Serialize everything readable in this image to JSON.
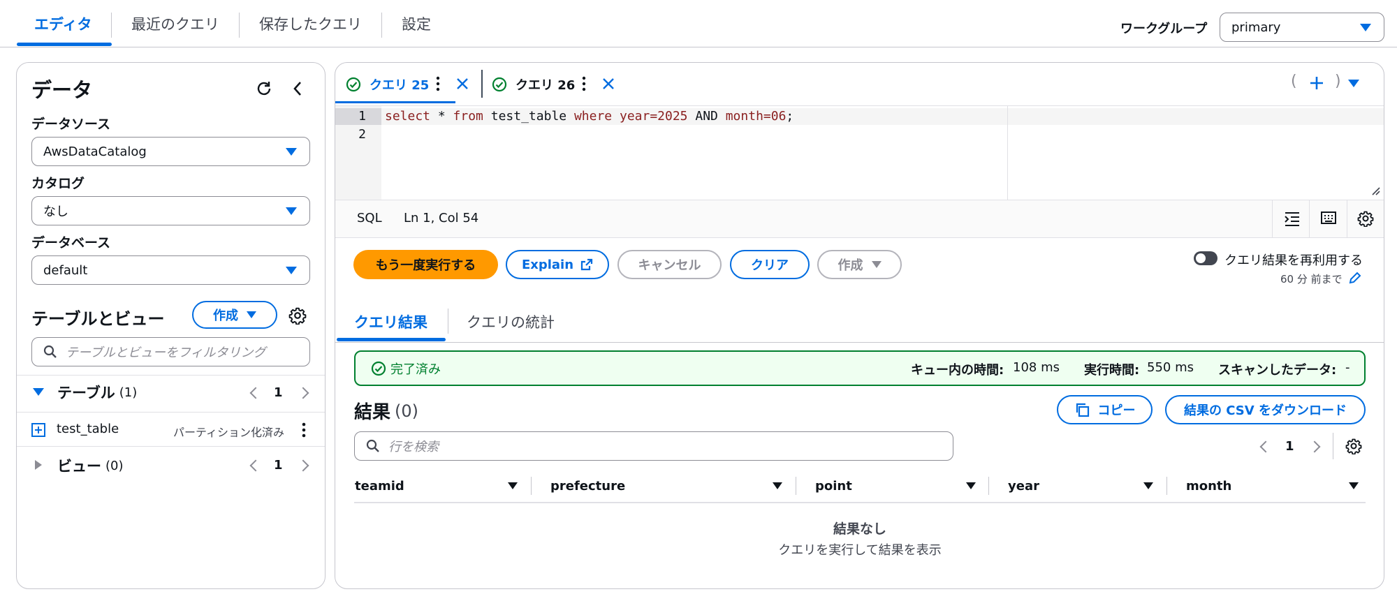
{
  "nav": {
    "tabs": [
      "エディタ",
      "最近のクエリ",
      "保存したクエリ",
      "設定"
    ],
    "workgroup_label": "ワークグループ",
    "workgroup_value": "primary"
  },
  "left": {
    "title": "データ",
    "datasource_label": "データソース",
    "datasource_value": "AwsDataCatalog",
    "catalog_label": "カタログ",
    "catalog_value": "なし",
    "database_label": "データベース",
    "database_value": "default",
    "tables_views_title": "テーブルとビュー",
    "create_label": "作成",
    "filter_placeholder": "テーブルとビューをフィルタリング",
    "tables_label": "テーブル",
    "tables_count": "(1)",
    "tables_page": "1",
    "table_item": {
      "name": "test_table",
      "badge": "パーティション化済み"
    },
    "views_label": "ビュー",
    "views_count": "(0)",
    "views_page": "1"
  },
  "editor": {
    "tabs": [
      {
        "label": "クエリ 25",
        "active": true
      },
      {
        "label": "クエリ 26",
        "active": false
      }
    ],
    "line_numbers": [
      "1",
      "2"
    ],
    "code": {
      "kw1": "select",
      "t1": " * ",
      "kw2": "from",
      "t2": " test_table ",
      "kw3": "where",
      "t3": " ",
      "cond1": "year=2025",
      "t4": " AND ",
      "cond2": "month=06",
      "t5": ";"
    },
    "status_lang": "SQL",
    "status_pos": "Ln 1, Col 54",
    "bracket_left": "(",
    "bracket_right": ")"
  },
  "actions": {
    "run_again": "もう一度実行する",
    "explain": "Explain",
    "cancel": "キャンセル",
    "clear": "クリア",
    "create": "作成",
    "reuse_label": "クエリ結果を再利用する",
    "reuse_sub": "60 分 前まで"
  },
  "results": {
    "tabs": [
      "クエリ結果",
      "クエリの統計"
    ],
    "status": "完了済み",
    "queue_label": "キュー内の時間:",
    "queue_value": "108 ms",
    "exec_label": "実行時間:",
    "exec_value": "550 ms",
    "scan_label": "スキャンしたデータ:",
    "scan_value": "-",
    "title": "結果",
    "count": "(0)",
    "copy": "コピー",
    "download": "結果の CSV をダウンロード",
    "search_placeholder": "行を検索",
    "page": "1",
    "columns": [
      "teamid",
      "prefecture",
      "point",
      "year",
      "month"
    ],
    "empty_title": "結果なし",
    "empty_sub": "クエリを実行して結果を表示"
  },
  "colors": {
    "accent": "#006ce0",
    "primary_button": "#ff9900",
    "success": "#00802f",
    "success_bg": "#effff1"
  }
}
